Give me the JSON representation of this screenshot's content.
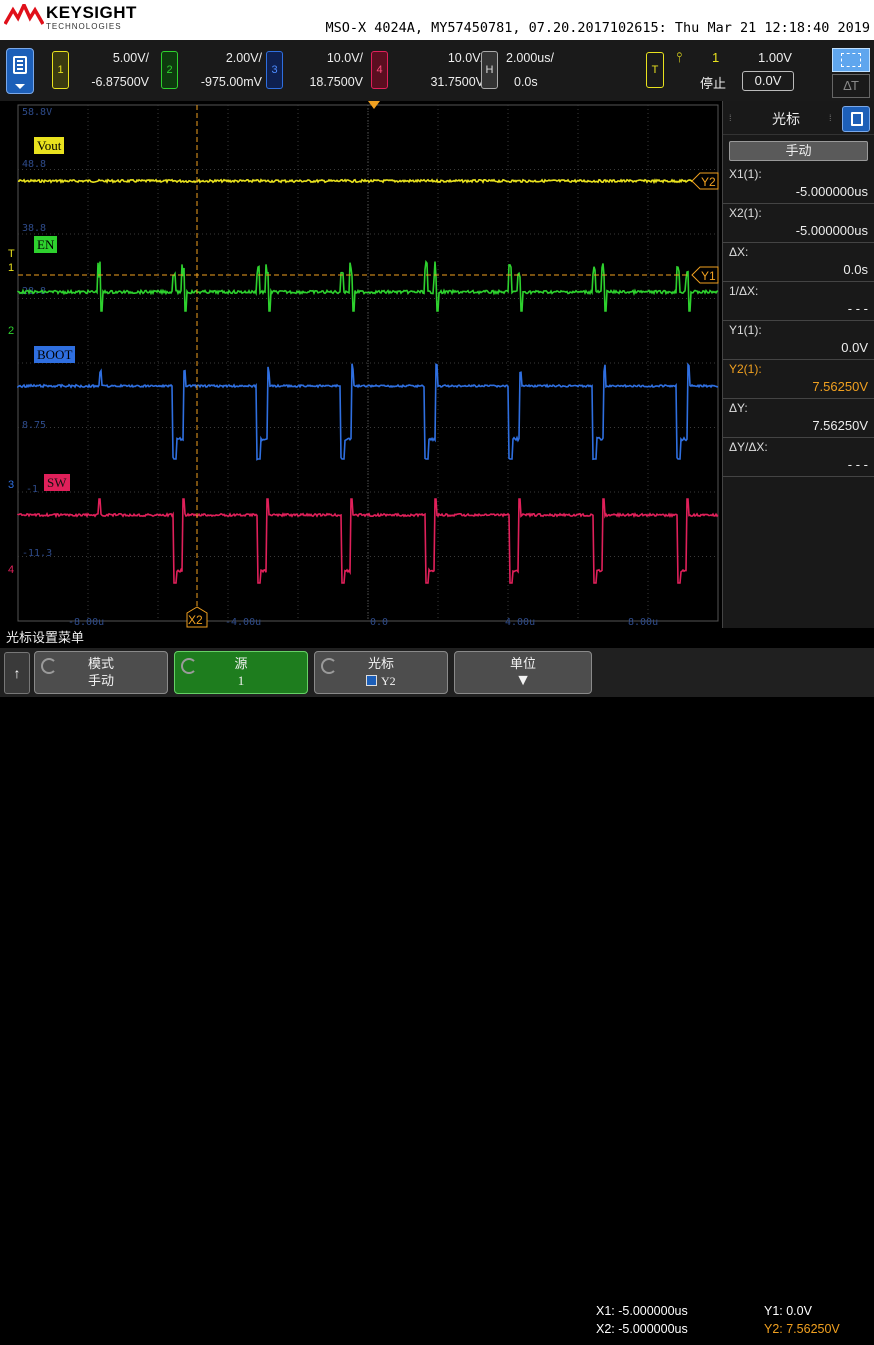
{
  "header": {
    "brand": "KEYSIGHT",
    "brand_sub": "TECHNOLOGIES",
    "title": "MSO-X 4024A, MY57450781, 07.20.2017102615: Thu Mar 21 12:18:40 2019"
  },
  "channels": [
    {
      "num": "1",
      "scale": "5.00V/",
      "offset": "-6.87500V",
      "color": "#e9e21e"
    },
    {
      "num": "2",
      "scale": "2.00V/",
      "offset": "-975.00mV",
      "color": "#2ed12e"
    },
    {
      "num": "3",
      "scale": "10.0V/",
      "offset": "18.7500V",
      "color": "#2f6fe0"
    },
    {
      "num": "4",
      "scale": "10.0V/",
      "offset": "31.7500V",
      "color": "#e0205a"
    }
  ],
  "timebase": {
    "box": "H",
    "scale": "2.000us/",
    "delay": "0.0s"
  },
  "trigger": {
    "box": "T",
    "source": "1",
    "level": "1.00V",
    "status": "停止",
    "offset": "0.0V"
  },
  "measure_btn": "ΔΤ",
  "waveform": {
    "labels": {
      "vout": "Vout",
      "en": "EN",
      "boot": "BOOT",
      "sw": "SW"
    },
    "grid_text": [
      "58.8V",
      "48.8",
      "38.8",
      "28.8",
      "8.75",
      "-1",
      "-11.3"
    ],
    "x_ticks": [
      "-8.00u",
      "-4.00u",
      "0.0",
      "4.00u",
      "8.00u"
    ],
    "cursor_labels": {
      "x2": "X2",
      "y1": "Y1",
      "y2": "Y2"
    }
  },
  "side_panel": {
    "title": "光标",
    "mode": "手动",
    "rows": [
      {
        "label": "X1(1):",
        "value": "-5.000000us",
        "selected": false
      },
      {
        "label": "X2(1):",
        "value": "-5.000000us",
        "selected": false
      },
      {
        "label": "ΔX:",
        "value": "0.0s",
        "selected": false
      },
      {
        "label": "1/ΔX:",
        "value": "- - -",
        "selected": false
      },
      {
        "label": "Y1(1):",
        "value": "0.0V",
        "selected": false
      },
      {
        "label": "Y2(1):",
        "value": "7.56250V",
        "selected": true
      },
      {
        "label": "ΔY:",
        "value": "7.56250V",
        "selected": false
      },
      {
        "label": "ΔY/ΔX:",
        "value": "- - -",
        "selected": false
      }
    ]
  },
  "bottom": {
    "menu_title": "光标设置菜单",
    "back": "↑",
    "softkeys": [
      {
        "label": "模式",
        "value": "手动"
      },
      {
        "label": "源",
        "value": "1"
      },
      {
        "label": "光标",
        "value": "Y2"
      },
      {
        "label": "单位",
        "value": ""
      }
    ],
    "info": {
      "x1": "X1: -5.000000us",
      "x2": "X2: -5.000000us",
      "y1": "Y1: 0.0V",
      "y2": "Y2: 7.56250V"
    }
  }
}
